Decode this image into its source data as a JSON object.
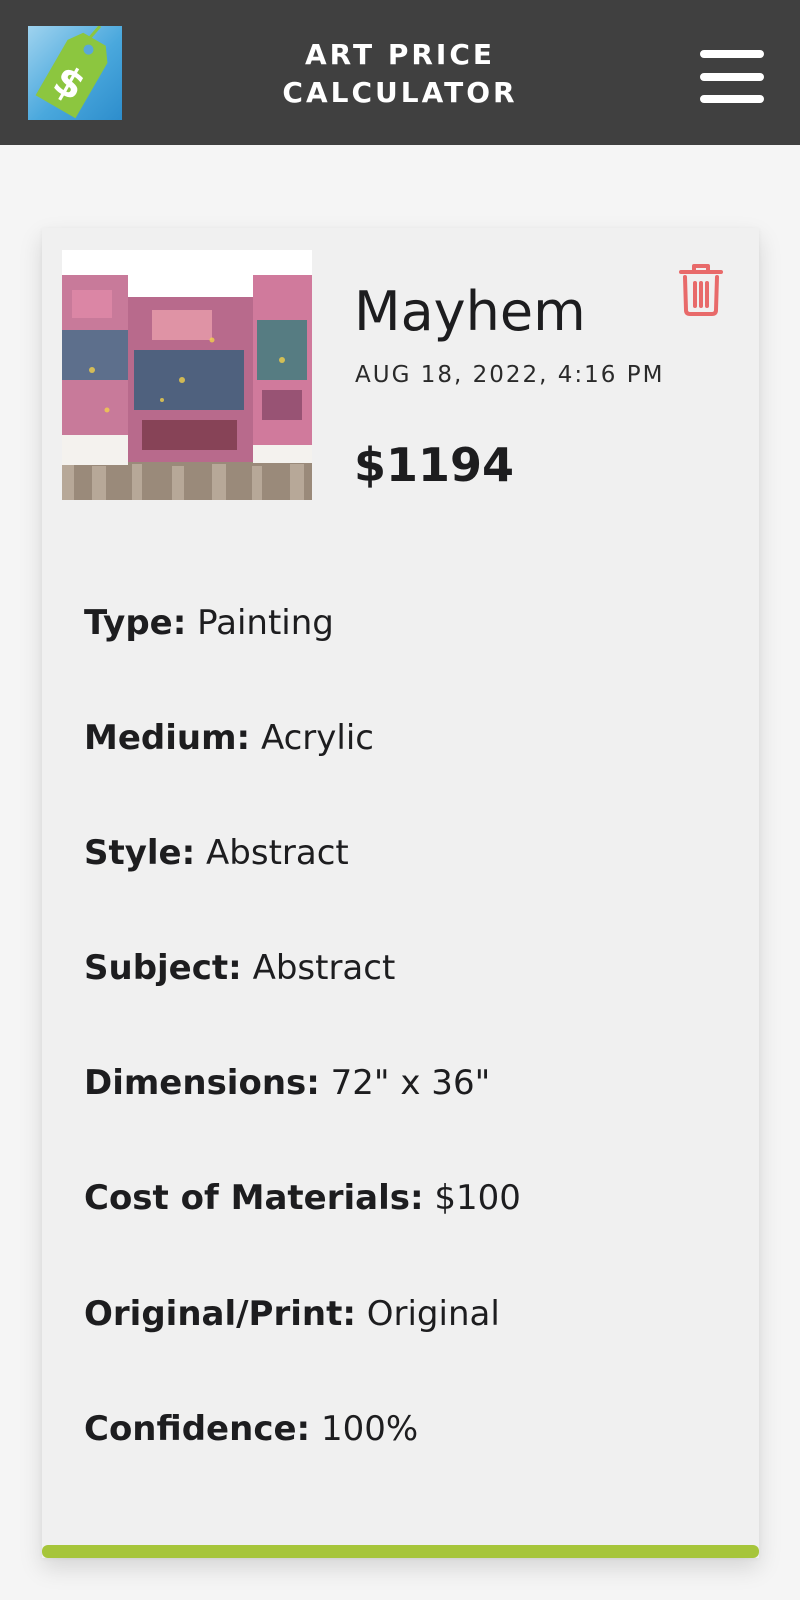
{
  "header": {
    "app_title": "ART PRICE CALCULATOR",
    "logo_icon": "price-tag-dollar-icon",
    "menu_icon": "hamburger-menu-icon"
  },
  "artwork": {
    "title": "Mayhem",
    "date": "AUG 18, 2022, 4:16 PM",
    "price": "$1194",
    "thumbnail_description": "abstract-painting-thumbnail",
    "delete_icon": "trash-icon"
  },
  "details": [
    {
      "label": "Type:",
      "value": "Painting"
    },
    {
      "label": "Medium:",
      "value": "Acrylic"
    },
    {
      "label": "Style:",
      "value": "Abstract"
    },
    {
      "label": "Subject:",
      "value": "Abstract"
    },
    {
      "label": "Dimensions:",
      "value": "72\" x 36\""
    },
    {
      "label": "Cost of Materials:",
      "value": "$100"
    },
    {
      "label": "Original/Print:",
      "value": "Original"
    },
    {
      "label": "Confidence:",
      "value": "100%"
    }
  ],
  "colors": {
    "header_bg": "#404040",
    "accent_green": "#a6c53a",
    "logo_green": "#8cc63f",
    "trash_red": "#e86a6a",
    "card_bg": "#f0f0f0"
  }
}
